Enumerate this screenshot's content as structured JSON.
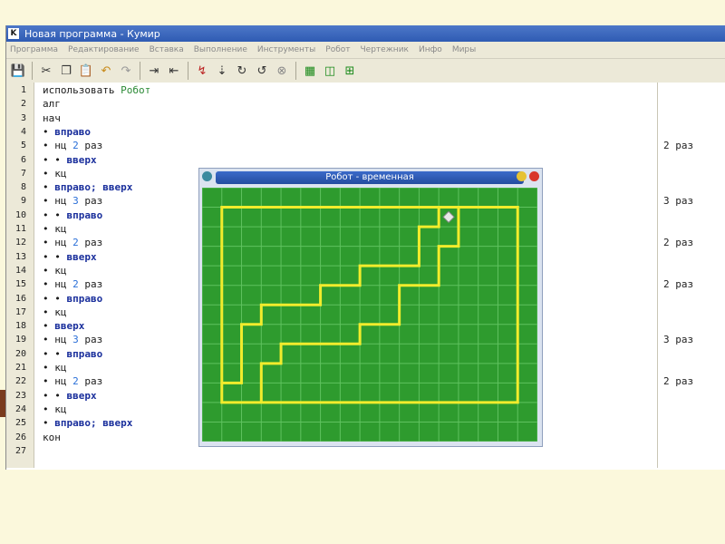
{
  "window": {
    "title": "Новая программа - Кумир",
    "app_icon_letter": "K"
  },
  "menu": [
    "Программа",
    "Редактирование",
    "Вставка",
    "Выполнение",
    "Инструменты",
    "Робот",
    "Чертежник",
    "Инфо",
    "Миры"
  ],
  "toolbar": {
    "icons": [
      "save-icon",
      "cut-icon",
      "copy-icon",
      "paste-icon",
      "undo-icon",
      "redo-icon",
      "indent-icon",
      "unindent-icon",
      "run-icon",
      "step-into-icon",
      "step-icon",
      "step-out-icon",
      "stop-icon",
      "robot-field-icon",
      "robot-panel-icon",
      "robot-grid-icon"
    ]
  },
  "code": {
    "lines": [
      {
        "n": "1",
        "segs": [
          {
            "t": "использовать ",
            "c": "kw"
          },
          {
            "t": "Робот",
            "c": "lib"
          }
        ]
      },
      {
        "n": "2",
        "segs": [
          {
            "t": "алг",
            "c": "kw"
          }
        ]
      },
      {
        "n": "3",
        "segs": [
          {
            "t": "нач",
            "c": "kw"
          }
        ]
      },
      {
        "n": "4",
        "segs": [
          {
            "t": "• ",
            "c": "kw"
          },
          {
            "t": "вправо",
            "c": "cmd"
          }
        ]
      },
      {
        "n": "5",
        "segs": [
          {
            "t": "• нц ",
            "c": "kw"
          },
          {
            "t": "2",
            "c": "num"
          },
          {
            "t": " раз",
            "c": "kw"
          }
        ]
      },
      {
        "n": "6",
        "segs": [
          {
            "t": "• • ",
            "c": "kw"
          },
          {
            "t": "вверх",
            "c": "cmd"
          }
        ]
      },
      {
        "n": "7",
        "segs": [
          {
            "t": "• кц",
            "c": "kw"
          }
        ]
      },
      {
        "n": "8",
        "segs": [
          {
            "t": "• ",
            "c": "kw"
          },
          {
            "t": "вправо; вверх",
            "c": "cmd"
          }
        ]
      },
      {
        "n": "9",
        "segs": [
          {
            "t": "• нц ",
            "c": "kw"
          },
          {
            "t": "3",
            "c": "num"
          },
          {
            "t": " раз",
            "c": "kw"
          }
        ]
      },
      {
        "n": "10",
        "segs": [
          {
            "t": "• • ",
            "c": "kw"
          },
          {
            "t": "вправо",
            "c": "cmd"
          }
        ]
      },
      {
        "n": "11",
        "segs": [
          {
            "t": "• кц",
            "c": "kw"
          }
        ]
      },
      {
        "n": "12",
        "segs": [
          {
            "t": "• нц ",
            "c": "kw"
          },
          {
            "t": "2",
            "c": "num"
          },
          {
            "t": " раз",
            "c": "kw"
          }
        ]
      },
      {
        "n": "13",
        "segs": [
          {
            "t": "• • ",
            "c": "kw"
          },
          {
            "t": "вверх",
            "c": "cmd"
          }
        ]
      },
      {
        "n": "14",
        "segs": [
          {
            "t": "• кц",
            "c": "kw"
          }
        ]
      },
      {
        "n": "15",
        "segs": [
          {
            "t": "• нц ",
            "c": "kw"
          },
          {
            "t": "2",
            "c": "num"
          },
          {
            "t": " раз",
            "c": "kw"
          }
        ]
      },
      {
        "n": "16",
        "segs": [
          {
            "t": "• • ",
            "c": "kw"
          },
          {
            "t": "вправо",
            "c": "cmd"
          }
        ]
      },
      {
        "n": "17",
        "segs": [
          {
            "t": "• кц",
            "c": "kw"
          }
        ]
      },
      {
        "n": "18",
        "segs": [
          {
            "t": "• ",
            "c": "kw"
          },
          {
            "t": "вверх",
            "c": "cmd"
          }
        ]
      },
      {
        "n": "19",
        "segs": [
          {
            "t": "• нц ",
            "c": "kw"
          },
          {
            "t": "3",
            "c": "num"
          },
          {
            "t": " раз",
            "c": "kw"
          }
        ]
      },
      {
        "n": "20",
        "segs": [
          {
            "t": "• • ",
            "c": "kw"
          },
          {
            "t": "вправо",
            "c": "cmd"
          }
        ]
      },
      {
        "n": "21",
        "segs": [
          {
            "t": "• кц",
            "c": "kw"
          }
        ]
      },
      {
        "n": "22",
        "segs": [
          {
            "t": "• нц ",
            "c": "kw"
          },
          {
            "t": "2",
            "c": "num"
          },
          {
            "t": " раз",
            "c": "kw"
          }
        ]
      },
      {
        "n": "23",
        "segs": [
          {
            "t": "• • ",
            "c": "kw"
          },
          {
            "t": "вверх",
            "c": "cmd"
          }
        ]
      },
      {
        "n": "24",
        "segs": [
          {
            "t": "• кц",
            "c": "kw"
          }
        ]
      },
      {
        "n": "25",
        "segs": [
          {
            "t": "• ",
            "c": "kw"
          },
          {
            "t": "вправо; вверх",
            "c": "cmd"
          }
        ]
      },
      {
        "n": "26",
        "segs": [
          {
            "t": "кон",
            "c": "kw"
          }
        ]
      },
      {
        "n": "27",
        "segs": []
      }
    ]
  },
  "margin_notes": [
    {
      "line": 5,
      "text": "2 раз"
    },
    {
      "line": 9,
      "text": "3 раз"
    },
    {
      "line": 12,
      "text": "2 раз"
    },
    {
      "line": 15,
      "text": "2 раз"
    },
    {
      "line": 19,
      "text": "3 раз"
    },
    {
      "line": 22,
      "text": "2 раз"
    }
  ],
  "robot_window": {
    "title": "Робот - временная",
    "field_color": "#2e9b2e",
    "grid_color": "#5fc25f",
    "wall_color": "#f2ec2c",
    "robot_color": "#e8e8e8",
    "walls": [
      [
        0,
        10
      ],
      [
        15,
        10
      ],
      [
        15,
        0
      ],
      [
        0,
        0
      ],
      [
        0,
        10
      ],
      [
        2,
        10
      ],
      [
        2,
        8
      ],
      [
        3,
        8
      ],
      [
        3,
        7
      ],
      [
        7,
        7
      ],
      [
        7,
        6
      ],
      [
        9,
        6
      ],
      [
        9,
        4
      ],
      [
        11,
        4
      ],
      [
        11,
        2
      ],
      [
        12,
        2
      ],
      [
        12,
        0
      ],
      [
        11,
        0
      ],
      [
        11,
        1
      ],
      [
        10,
        1
      ],
      [
        10,
        3
      ],
      [
        7,
        3
      ],
      [
        7,
        4
      ],
      [
        5,
        4
      ],
      [
        5,
        5
      ],
      [
        2,
        5
      ],
      [
        2,
        6
      ],
      [
        1,
        6
      ],
      [
        1,
        9
      ],
      [
        0,
        9
      ]
    ],
    "robot_cell": [
      11,
      0
    ]
  }
}
